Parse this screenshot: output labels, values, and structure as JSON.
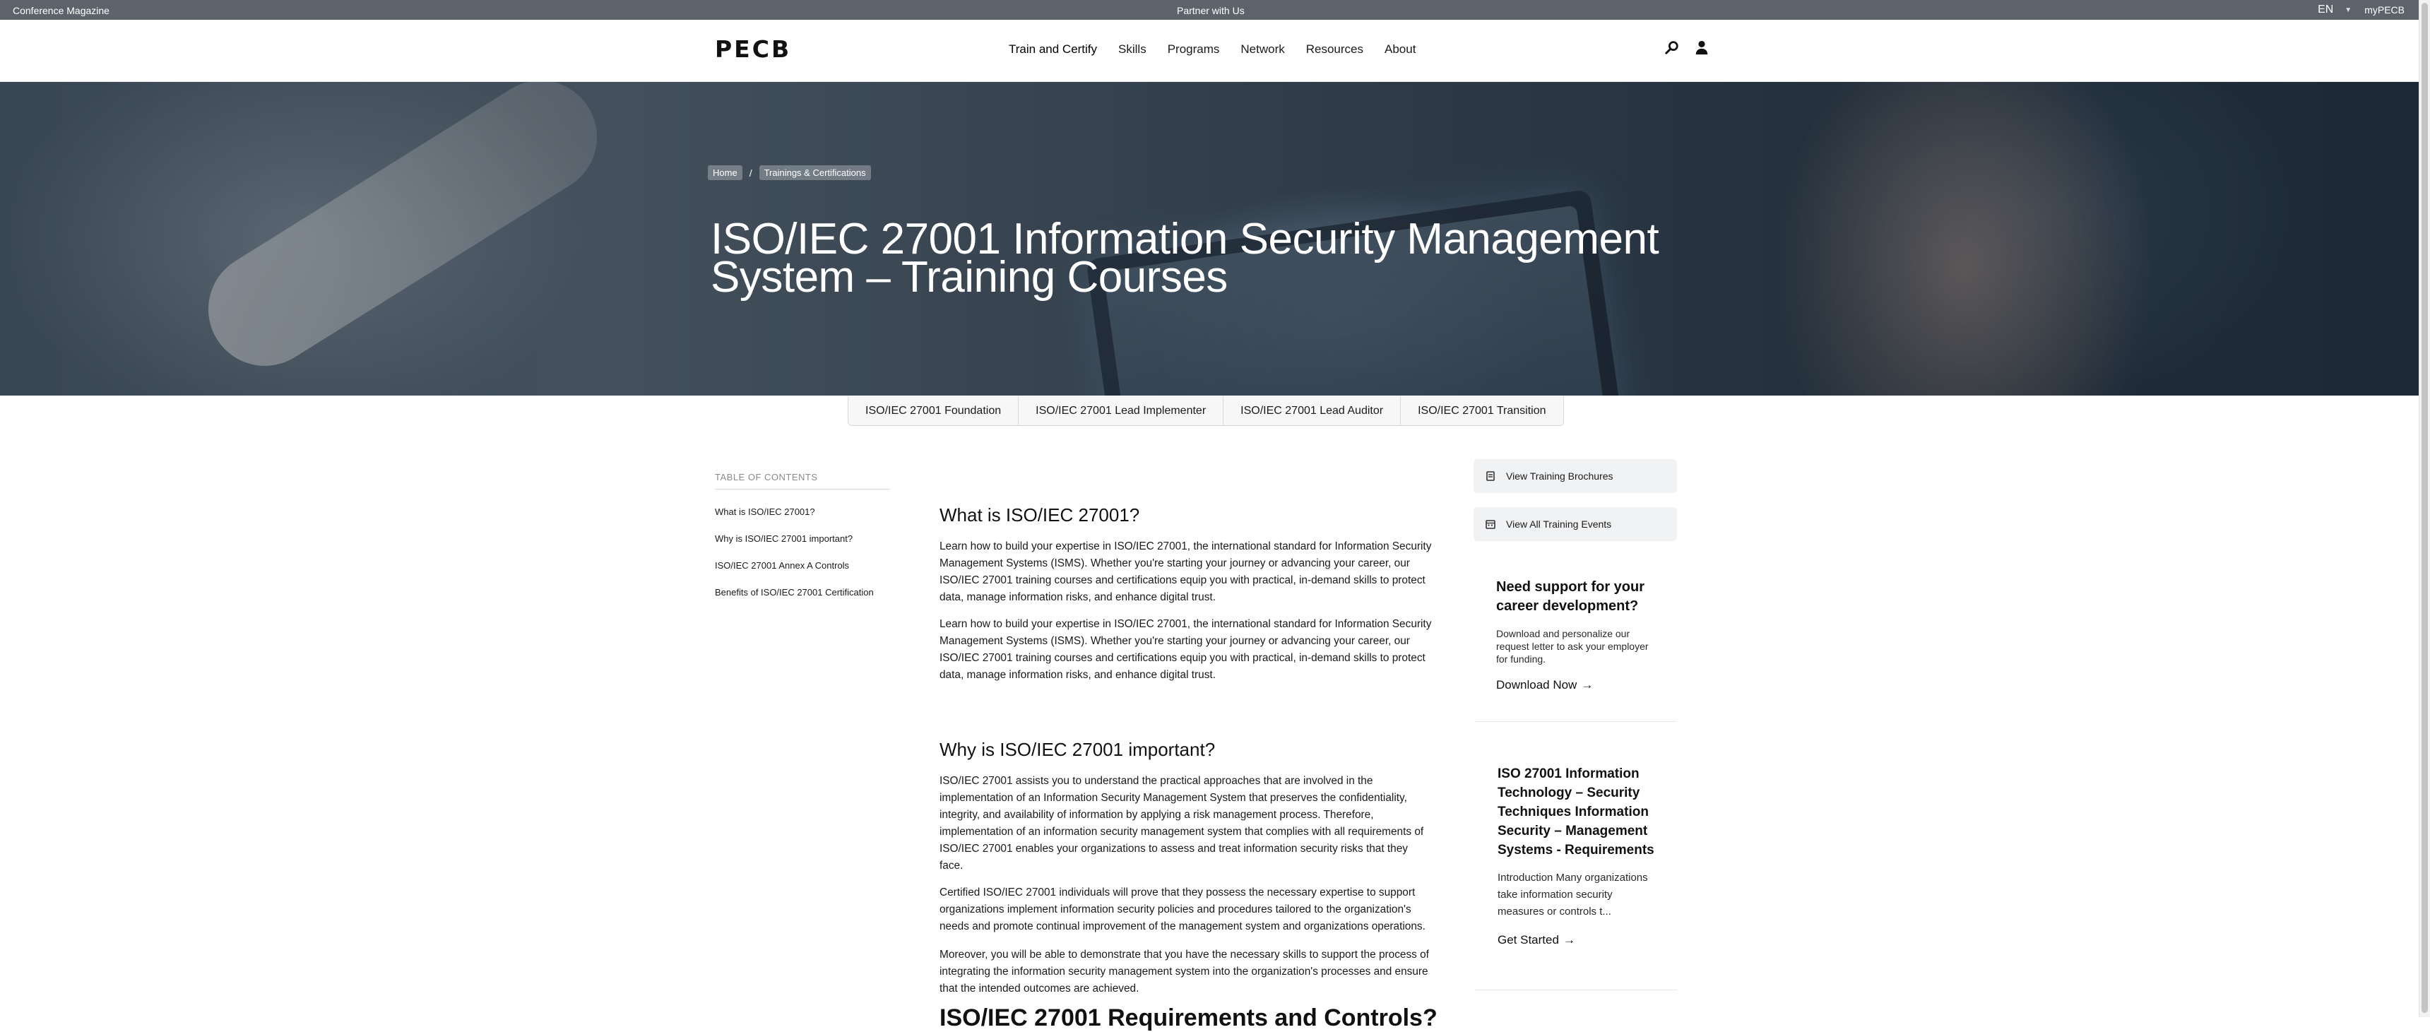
{
  "topbar": {
    "left_link": "Conference Magazine",
    "center_link": "Partner with Us",
    "language": "EN",
    "account_link": "myPECB"
  },
  "header": {
    "logo": "PECB",
    "nav": [
      "Train and Certify",
      "Skills",
      "Programs",
      "Network",
      "Resources",
      "About"
    ],
    "icons": [
      "search-icon",
      "user-icon"
    ]
  },
  "hero": {
    "breadcrumb": [
      "Home",
      "Trainings & Certifications"
    ],
    "breadcrumb_separator": "/",
    "title": "ISO/IEC 27001 Information Security Management System – Training Courses"
  },
  "tabs": [
    "ISO/IEC 27001 Foundation",
    "ISO/IEC 27001 Lead Implementer",
    "ISO/IEC 27001 Lead Auditor",
    "ISO/IEC 27001 Transition"
  ],
  "toc": {
    "title": "TABLE OF CONTENTS",
    "items": [
      "What is ISO/IEC 27001?",
      "Why is ISO/IEC 27001 important?",
      "ISO/IEC 27001 Annex A Controls",
      "Benefits of ISO/IEC 27001 Certification"
    ]
  },
  "content": {
    "what_heading": "What is ISO/IEC 27001?",
    "what_p1": "Learn how to build your expertise in ISO/IEC 27001, the international standard for Information Security Management Systems (ISMS). Whether you're starting your journey or advancing your career, our ISO/IEC 27001 training courses and certifications equip you with practical, in-demand skills to protect data, manage information risks, and enhance digital trust.",
    "what_p2": "Learn how to build your expertise in ISO/IEC 27001, the international standard for Information Security Management Systems (ISMS). Whether you're starting your journey or advancing your career, our ISO/IEC 27001 training courses and certifications equip you with practical, in-demand skills to protect data, manage information risks, and enhance digital trust.",
    "why_heading": "Why is ISO/IEC 27001 important?",
    "why_p1": "ISO/IEC 27001 assists you to understand the practical approaches that are involved in the implementation of an Information Security Management System that preserves the confidentiality, integrity, and availability of information by applying a risk management process. Therefore, implementation of an information security management system that complies with all requirements of ISO/IEC 27001 enables your organizations to assess and treat information security risks that they face.",
    "why_p2": "Certified ISO/IEC 27001 individuals will prove that they possess the necessary expertise to support organizations implement information security policies and procedures tailored to the organization's needs and promote continual improvement of the management system and organizations operations.",
    "why_p3": "Moreover, you will be able to demonstrate that you have the necessary skills to support the process of integrating the information security management system into the organization's processes and ensure that the intended outcomes are achieved.",
    "next_heading": "ISO/IEC 27001 Requirements and Controls?"
  },
  "sidebar": {
    "brochures_label": "View Training Brochures",
    "events_label": "View All Training Events",
    "support_card": {
      "title": "Need support for your career development?",
      "text": "Download and personalize our request letter to ask your employer for funding.",
      "link": "Download Now"
    },
    "standard_card": {
      "title": "ISO 27001 Information Technology – Security Techniques Information Security – Management Systems - Requirements",
      "text": "Introduction Many organizations take information security measures or controls t...",
      "link": "Get Started"
    }
  }
}
